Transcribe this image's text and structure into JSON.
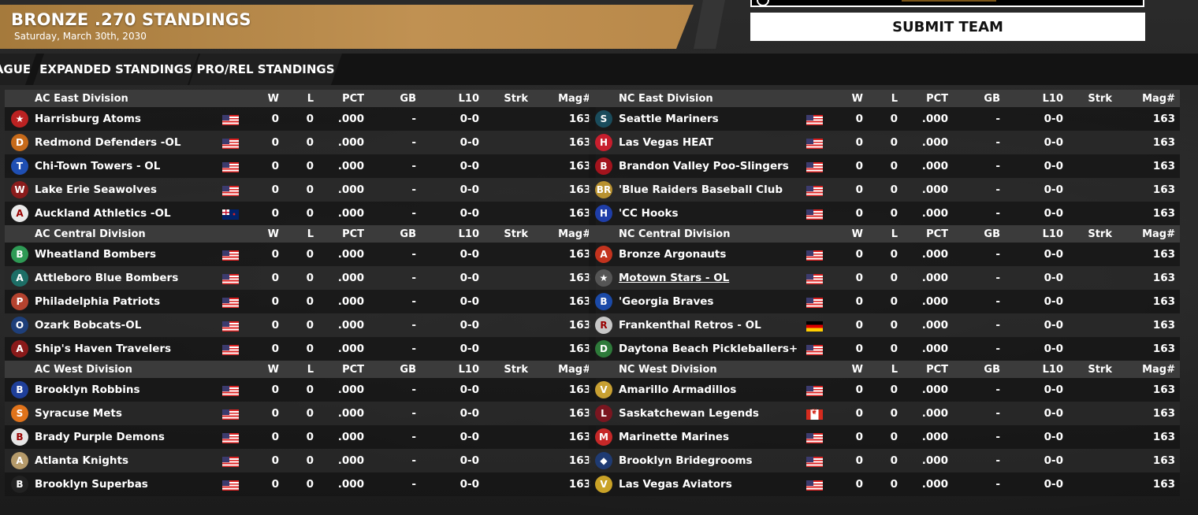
{
  "header": {
    "title": "BRONZE .270 STANDINGS",
    "date": "Saturday, March 30th, 2030",
    "submit_label": "SUBMIT TEAM"
  },
  "tabs": [
    {
      "label": "AGUE"
    },
    {
      "label": "EXPANDED STANDINGS"
    },
    {
      "label": "PRO/REL STANDINGS"
    }
  ],
  "columns": [
    "W",
    "L",
    "PCT",
    "GB",
    "L10",
    "Strk",
    "Mag#"
  ],
  "left_divisions": [
    {
      "name": "AC East Division",
      "teams": [
        {
          "name": "Harrisburg Atoms",
          "logo": "atoms-logo",
          "flag": "us",
          "w": "0",
          "l": "0",
          "pct": ".000",
          "gb": "-",
          "l10": "0-0",
          "strk": "",
          "mag": "163"
        },
        {
          "name": "Redmond Defenders      -OL",
          "logo": "defenders-logo",
          "flag": "us",
          "w": "0",
          "l": "0",
          "pct": ".000",
          "gb": "-",
          "l10": "0-0",
          "strk": "",
          "mag": "163"
        },
        {
          "name": "Chi-Town Towers - OL",
          "logo": "towers-logo",
          "flag": "us",
          "w": "0",
          "l": "0",
          "pct": ".000",
          "gb": "-",
          "l10": "0-0",
          "strk": "",
          "mag": "163"
        },
        {
          "name": "Lake Erie Seawolves",
          "logo": "seawolves-logo",
          "flag": "us",
          "w": "0",
          "l": "0",
          "pct": ".000",
          "gb": "-",
          "l10": "0-0",
          "strk": "",
          "mag": "163"
        },
        {
          "name": "Auckland Athletics -OL",
          "logo": "athletics-logo",
          "flag": "nz",
          "w": "0",
          "l": "0",
          "pct": ".000",
          "gb": "-",
          "l10": "0-0",
          "strk": "",
          "mag": "163"
        }
      ]
    },
    {
      "name": "AC Central Division",
      "teams": [
        {
          "name": "Wheatland Bombers",
          "logo": "bombers-logo",
          "flag": "us",
          "w": "0",
          "l": "0",
          "pct": ".000",
          "gb": "-",
          "l10": "0-0",
          "strk": "",
          "mag": "163"
        },
        {
          "name": "Attleboro Blue Bombers",
          "logo": "blue-bombers-logo",
          "flag": "us",
          "w": "0",
          "l": "0",
          "pct": ".000",
          "gb": "-",
          "l10": "0-0",
          "strk": "",
          "mag": "163"
        },
        {
          "name": "Philadelphia Patriots",
          "logo": "patriots-logo",
          "flag": "us",
          "w": "0",
          "l": "0",
          "pct": ".000",
          "gb": "-",
          "l10": "0-0",
          "strk": "",
          "mag": "163"
        },
        {
          "name": "Ozark Bobcats-OL",
          "logo": "bobcats-logo",
          "flag": "us",
          "w": "0",
          "l": "0",
          "pct": ".000",
          "gb": "-",
          "l10": "0-0",
          "strk": "",
          "mag": "163"
        },
        {
          "name": "Ship's Haven Travelers",
          "logo": "travelers-logo",
          "flag": "us",
          "w": "0",
          "l": "0",
          "pct": ".000",
          "gb": "-",
          "l10": "0-0",
          "strk": "",
          "mag": "163"
        }
      ]
    },
    {
      "name": "AC West Division",
      "teams": [
        {
          "name": "Brooklyn Robbins",
          "logo": "robbins-logo",
          "flag": "us",
          "w": "0",
          "l": "0",
          "pct": ".000",
          "gb": "-",
          "l10": "0-0",
          "strk": "",
          "mag": "163"
        },
        {
          "name": "Syracuse Mets",
          "logo": "mets-logo",
          "flag": "us",
          "w": "0",
          "l": "0",
          "pct": ".000",
          "gb": "-",
          "l10": "0-0",
          "strk": "",
          "mag": "163"
        },
        {
          "name": "Brady Purple Demons",
          "logo": "demons-logo",
          "flag": "us",
          "w": "0",
          "l": "0",
          "pct": ".000",
          "gb": "-",
          "l10": "0-0",
          "strk": "",
          "mag": "163"
        },
        {
          "name": "Atlanta Knights",
          "logo": "knights-logo",
          "flag": "us",
          "w": "0",
          "l": "0",
          "pct": ".000",
          "gb": "-",
          "l10": "0-0",
          "strk": "",
          "mag": "163"
        },
        {
          "name": "Brooklyn Superbas",
          "logo": "superbas-logo",
          "flag": "us",
          "w": "0",
          "l": "0",
          "pct": ".000",
          "gb": "-",
          "l10": "0-0",
          "strk": "",
          "mag": "163"
        }
      ]
    }
  ],
  "right_divisions": [
    {
      "name": "NC East Division",
      "teams": [
        {
          "name": "Seattle  Mariners",
          "logo": "mariners-logo",
          "flag": "us",
          "w": "0",
          "l": "0",
          "pct": ".000",
          "gb": "-",
          "l10": "0-0",
          "strk": "",
          "mag": "163"
        },
        {
          "name": "Las Vegas HEAT",
          "logo": "heat-logo",
          "flag": "us",
          "w": "0",
          "l": "0",
          "pct": ".000",
          "gb": "-",
          "l10": "0-0",
          "strk": "",
          "mag": "163"
        },
        {
          "name": "Brandon Valley Poo-Slingers",
          "logo": "poo-slingers-logo",
          "flag": "us",
          "w": "0",
          "l": "0",
          "pct": ".000",
          "gb": "-",
          "l10": "0-0",
          "strk": "",
          "mag": "163"
        },
        {
          "name": "'Blue Raiders Baseball Club",
          "logo": "blue-raiders-logo",
          "flag": "us",
          "w": "0",
          "l": "0",
          "pct": ".000",
          "gb": "-",
          "l10": "0-0",
          "strk": "",
          "mag": "163"
        },
        {
          "name": "'CC Hooks",
          "logo": "hooks-logo",
          "flag": "us",
          "w": "0",
          "l": "0",
          "pct": ".000",
          "gb": "-",
          "l10": "0-0",
          "strk": "",
          "mag": "163"
        }
      ]
    },
    {
      "name": "NC Central Division",
      "teams": [
        {
          "name": "Bronze Argonauts",
          "logo": "argonauts-logo",
          "flag": "us",
          "w": "0",
          "l": "0",
          "pct": ".000",
          "gb": "-",
          "l10": "0-0",
          "strk": "",
          "mag": "163"
        },
        {
          "name": "Motown Stars - OL",
          "logo": "stars-logo",
          "flag": "us",
          "w": "0",
          "l": "0",
          "pct": ".000",
          "gb": "-",
          "l10": "0-0",
          "strk": "",
          "mag": "163",
          "underline": true
        },
        {
          "name": "'Georgia Braves",
          "logo": "braves-logo",
          "flag": "us",
          "w": "0",
          "l": "0",
          "pct": ".000",
          "gb": "-",
          "l10": "0-0",
          "strk": "",
          "mag": "163"
        },
        {
          "name": "Frankenthal Retros - OL",
          "logo": "retros-logo",
          "flag": "de",
          "w": "0",
          "l": "0",
          "pct": ".000",
          "gb": "-",
          "l10": "0-0",
          "strk": "",
          "mag": "163"
        },
        {
          "name": "Daytona Beach Pickleballers+",
          "logo": "pickleballers-logo",
          "flag": "us",
          "w": "0",
          "l": "0",
          "pct": ".000",
          "gb": "-",
          "l10": "0-0",
          "strk": "",
          "mag": "163"
        }
      ]
    },
    {
      "name": "NC West Division",
      "teams": [
        {
          "name": "Amarillo Armadillos",
          "logo": "armadillos-logo",
          "flag": "us",
          "w": "0",
          "l": "0",
          "pct": ".000",
          "gb": "-",
          "l10": "0-0",
          "strk": "",
          "mag": "163"
        },
        {
          "name": "Saskatchewan Legends",
          "logo": "legends-logo",
          "flag": "ca",
          "w": "0",
          "l": "0",
          "pct": ".000",
          "gb": "-",
          "l10": "0-0",
          "strk": "",
          "mag": "163"
        },
        {
          "name": "Marinette Marines",
          "logo": "marines-logo",
          "flag": "us",
          "w": "0",
          "l": "0",
          "pct": ".000",
          "gb": "-",
          "l10": "0-0",
          "strk": "",
          "mag": "163"
        },
        {
          "name": "Brooklyn Bridegrooms",
          "logo": "bridegrooms-logo",
          "flag": "us",
          "w": "0",
          "l": "0",
          "pct": ".000",
          "gb": "-",
          "l10": "0-0",
          "strk": "",
          "mag": "163"
        },
        {
          "name": "Las Vegas Aviators",
          "logo": "aviators-logo",
          "flag": "us",
          "w": "0",
          "l": "0",
          "pct": ".000",
          "gb": "-",
          "l10": "0-0",
          "strk": "",
          "mag": "163"
        }
      ]
    }
  ]
}
